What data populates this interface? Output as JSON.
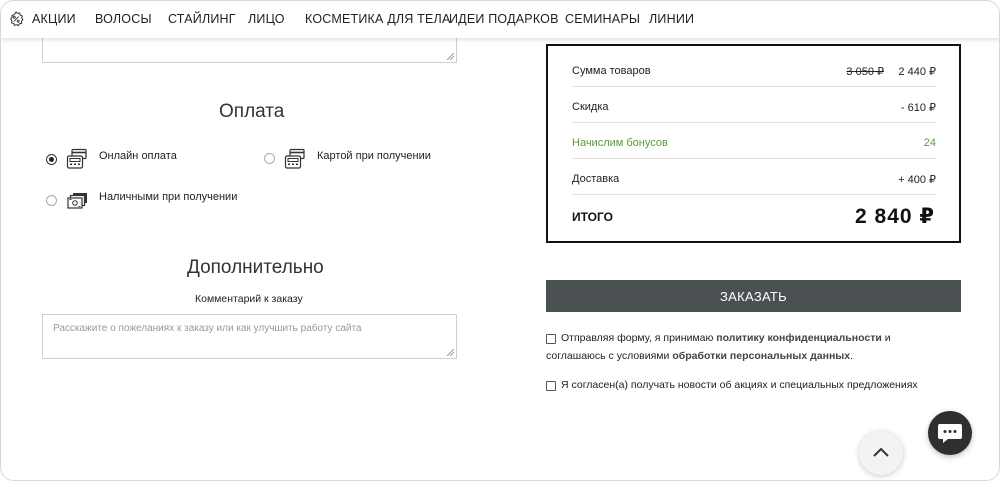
{
  "nav": {
    "items": [
      "АКЦИИ",
      "ВОЛОСЫ",
      "СТАЙЛИНГ",
      "ЛИЦО",
      "КОСМЕТИКА ДЛЯ ТЕЛА",
      "ИДЕИ ПОДАРКОВ",
      "СЕМИНАРЫ",
      "ЛИНИИ"
    ],
    "promo_icon": "percent-badge-icon"
  },
  "payment": {
    "title": "Оплата",
    "options": [
      {
        "label": "Онлайн оплата",
        "selected": true,
        "icon": "card-terminal-icon"
      },
      {
        "label": "Картой при получении",
        "selected": false,
        "icon": "card-terminal-icon"
      },
      {
        "label": "Наличными при получении",
        "selected": false,
        "icon": "cash-icon"
      }
    ]
  },
  "extra": {
    "title": "Дополнительно",
    "comment_label": "Комментарий к заказу",
    "comment_placeholder": "Расскажите о пожеланиях к заказу или как улучшить работу сайта"
  },
  "summary": {
    "rows": [
      {
        "label": "Сумма товаров",
        "old_value": "3 050 ₽",
        "value": "2 440 ₽"
      },
      {
        "label": "Скидка",
        "value": "- 610 ₽"
      },
      {
        "label": "Начислим бонусов",
        "value": "24"
      },
      {
        "label": "Доставка",
        "value": "+ 400 ₽"
      }
    ],
    "total_label": "ИТОГО",
    "total_value": "2 840 ₽",
    "bonus_color": "#5a9a3a"
  },
  "order_button": "ЗАКАЗАТЬ",
  "consent": {
    "privacy_pre": "Отправляя форму, я принимаю ",
    "privacy_link": "политику конфиденциальности",
    "privacy_mid": " и",
    "privacy_line2_pre": "соглашаюсь с условиями ",
    "privacy_link2": "обработки персональных данных",
    "privacy_end": ".",
    "newsletter": "Я согласен(а) получать новости об акциях и специальных предложениях"
  },
  "floating": {
    "scroll_up_icon": "chevron-up-icon",
    "chat_icon": "chat-bubble-icon"
  },
  "colors": {
    "order_button_bg": "#4b5153",
    "chat_button_bg": "#2d2f30"
  }
}
